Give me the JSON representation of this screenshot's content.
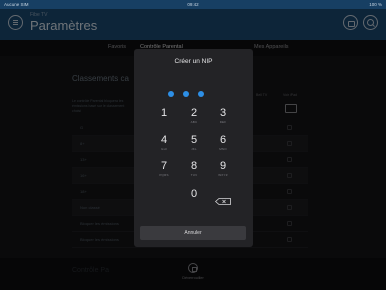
{
  "status_bar": {
    "carrier": "Aucune SIM",
    "time": "09:42",
    "battery": "100 %"
  },
  "header": {
    "app_name": "Fibe TV",
    "title": "Paramètres"
  },
  "tabs": [
    {
      "label": "Favoris"
    },
    {
      "label": "Contrôle Parental"
    },
    {
      "label": "Mes Appareils"
    }
  ],
  "content": {
    "section_title": "Classements ca",
    "description": "Le contrôle Parental bloquera les émissions basé sur le classement choisi",
    "col_headers": [
      "Bell TV",
      "Voir iPad"
    ],
    "rows": [
      {
        "label": "G"
      },
      {
        "label": "8+"
      },
      {
        "label": "13+"
      },
      {
        "label": "16+"
      },
      {
        "label": "18+"
      },
      {
        "label": "Non classé"
      },
      {
        "label": "Bloquer les émissions"
      },
      {
        "label": "Bloquer les émissions"
      }
    ]
  },
  "bottom_bar": {
    "faint_text": "Contrôle Pa",
    "lock_label": "Déverrouiller"
  },
  "pin_modal": {
    "title": "Créer un NIP",
    "entered_digits": 3,
    "dot_color": "#2d8fe6",
    "keys": [
      {
        "digit": "1",
        "letters": ""
      },
      {
        "digit": "2",
        "letters": "ABC"
      },
      {
        "digit": "3",
        "letters": "DEF"
      },
      {
        "digit": "4",
        "letters": "GHI"
      },
      {
        "digit": "5",
        "letters": "JKL"
      },
      {
        "digit": "6",
        "letters": "MNO"
      },
      {
        "digit": "7",
        "letters": "PQRS"
      },
      {
        "digit": "8",
        "letters": "TUV"
      },
      {
        "digit": "9",
        "letters": "WXYZ"
      },
      {
        "digit": "0",
        "letters": ""
      }
    ],
    "backspace_icon": "backspace-icon",
    "cancel_label": "Annuler"
  }
}
